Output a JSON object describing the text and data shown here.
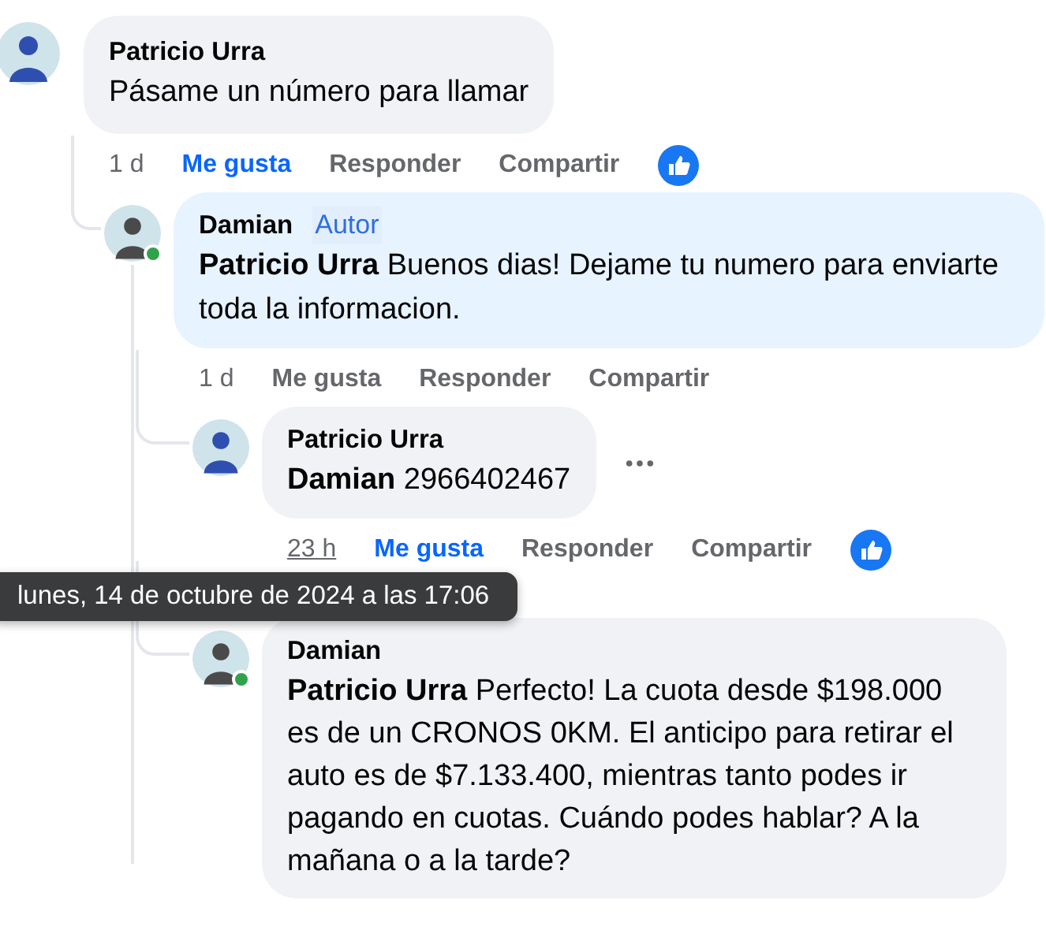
{
  "comments": [
    {
      "author": "Patricio Urra",
      "color": "#2f4fb0",
      "text": "Pásame un número para llamar",
      "time": "1 d",
      "like": "Me gusta",
      "liked": true,
      "reply": "Responder",
      "share": "Compartir",
      "reaction": true,
      "time_hovered": false,
      "children": [
        {
          "author": "Damian",
          "badge": "Autor",
          "color": "#4a4a4a",
          "online": true,
          "text": "**Patricio Urra** Buenos dias! Dejame tu numero para enviarte toda la informacion.",
          "time": "1 d",
          "like": "Me gusta",
          "liked": false,
          "reply": "Responder",
          "share": "Compartir",
          "time_hovered": false,
          "children": [
            {
              "author": "Patricio Urra",
              "color": "#2f4fb0",
              "text": "**Damian** 2966402467",
              "time": "23 h",
              "like": "Me gusta",
              "liked": true,
              "reply": "Responder",
              "share": "Compartir",
              "reaction": true,
              "more": true,
              "time_hovered": true,
              "time_tooltip": "lunes, 14 de octubre de 2024 a las 17:06"
            },
            {
              "author": "Damian",
              "color": "#4a4a4a",
              "online": true,
              "text": "**Patricio Urra** Perfecto! La cuota desde $198.000 es de un CRONOS 0KM. El anticipo para retirar el auto es de $7.133.400, mientras tanto podes ir pagando en cuotas. Cuándo podes hablar? A la mañana o a la tarde?"
            }
          ]
        }
      ]
    }
  ]
}
